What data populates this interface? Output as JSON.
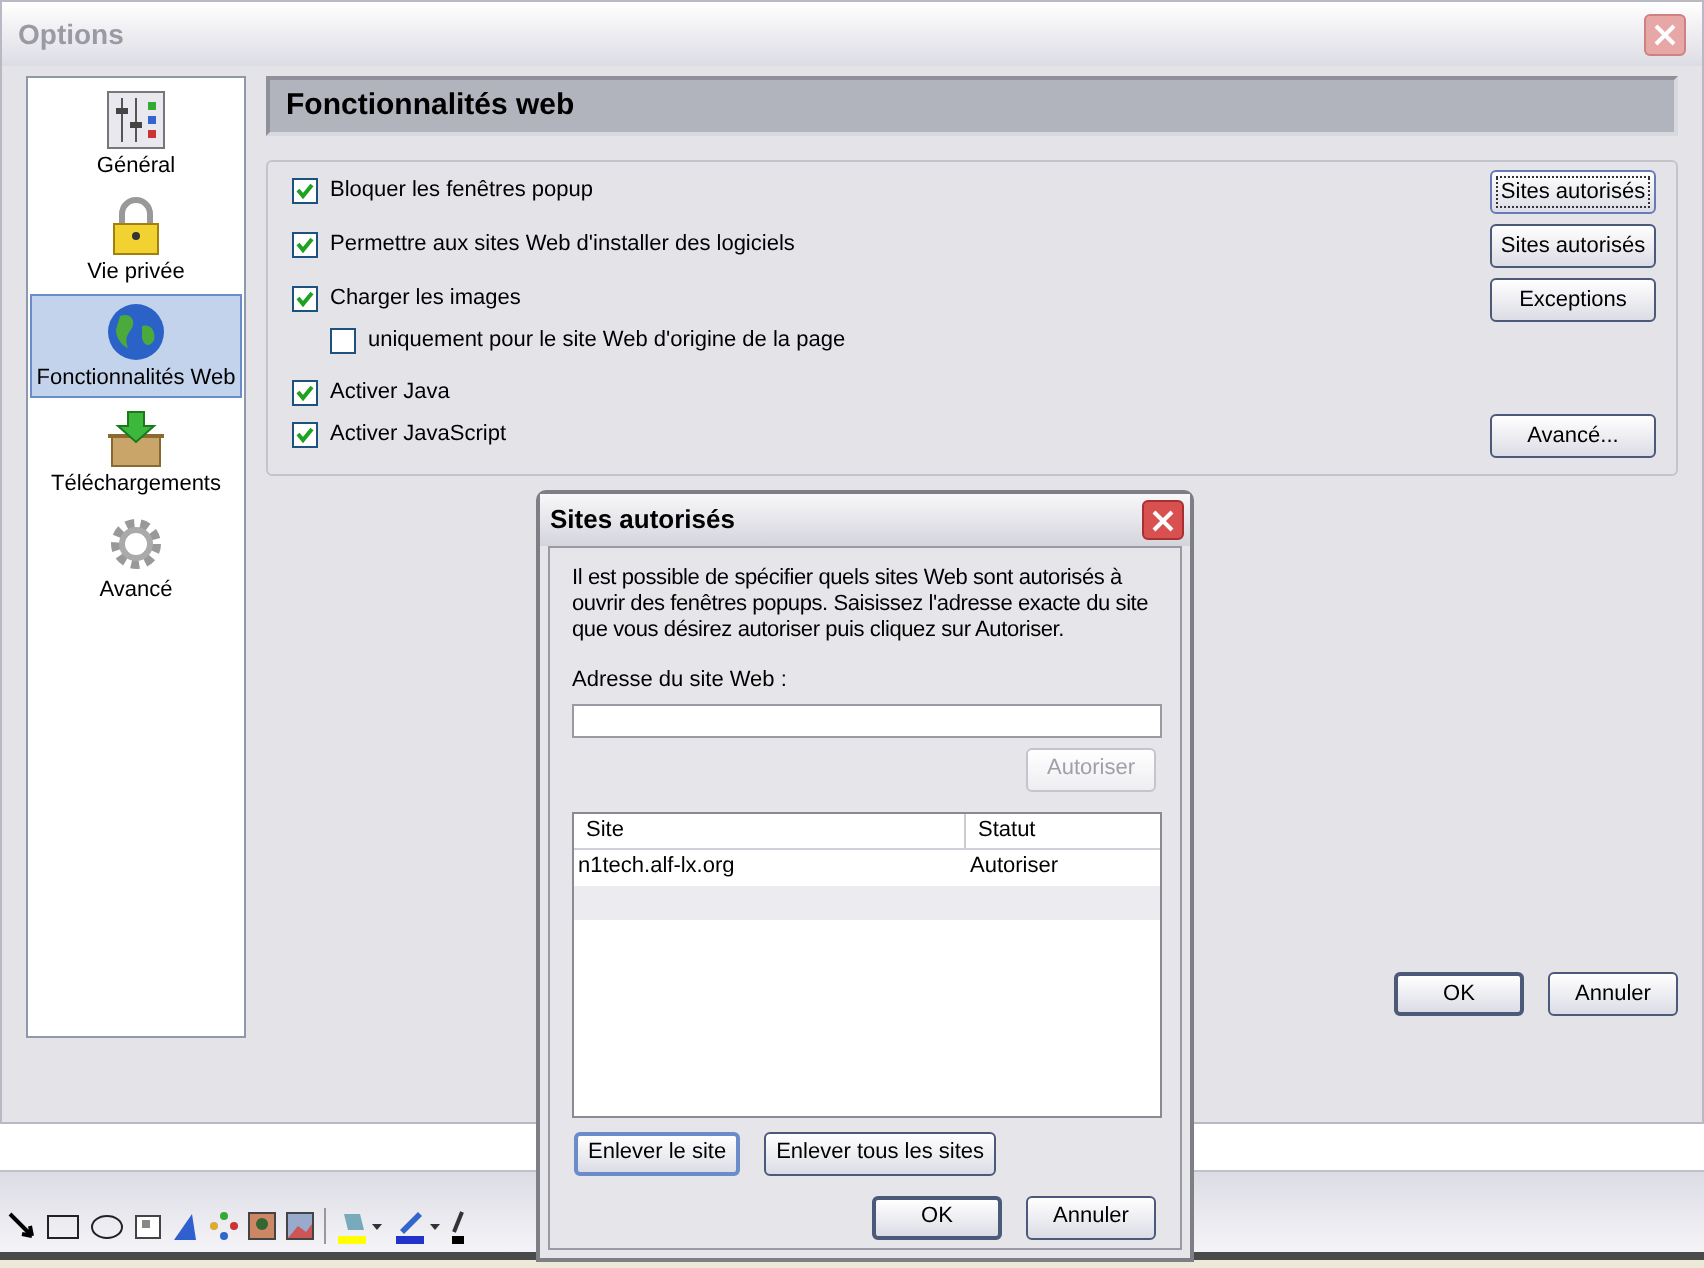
{
  "window": {
    "title": "Options"
  },
  "sidebar": {
    "items": [
      {
        "label": "Général",
        "selected": false
      },
      {
        "label": "Vie privée",
        "selected": false
      },
      {
        "label": "Fonctionnalités Web",
        "selected": true
      },
      {
        "label": "Téléchargements",
        "selected": false
      },
      {
        "label": "Avancé",
        "selected": false
      }
    ]
  },
  "section_title": "Fonctionnalités web",
  "options": [
    {
      "label": "Bloquer les fenêtres popup",
      "checked": true,
      "button": {
        "label": "Sites autorisés",
        "focused": true
      }
    },
    {
      "label": "Permettre aux sites Web d'installer des logiciels",
      "checked": true,
      "button": {
        "label": "Sites autorisés",
        "focused": false
      }
    },
    {
      "label": "Charger les images",
      "checked": true,
      "button": {
        "label": "Exceptions",
        "focused": false
      },
      "children": [
        {
          "label": "uniquement pour le site Web d'origine de la page",
          "checked": false
        }
      ]
    },
    {
      "label": "Activer Java",
      "checked": true
    },
    {
      "label": "Activer JavaScript",
      "checked": true,
      "button": {
        "label": "Avancé...",
        "focused": false
      }
    }
  ],
  "footer_buttons": [
    {
      "label": "OK",
      "default": true
    },
    {
      "label": "Annuler",
      "default": false
    }
  ],
  "dialog": {
    "title": "Sites autorisés",
    "description": "Il est possible de spécifier quels sites Web sont autorisés à ouvrir des fenêtres popups. Saisissez l'adresse exacte du site que vous désirez autoriser puis cliquez sur Autoriser.",
    "field_label": "Adresse du site Web :",
    "allow_button": {
      "label": "Autoriser",
      "disabled": true
    },
    "table": {
      "columns": [
        "Site",
        "Statut"
      ],
      "rows": [
        {
          "site": "n1tech.alf-lx.org",
          "status": "Autoriser"
        }
      ]
    },
    "remove_buttons": [
      {
        "label": "Enlever le site",
        "focused": true
      },
      {
        "label": "Enlever tous les sites",
        "focused": false
      }
    ],
    "buttons": [
      {
        "label": "OK",
        "default": true
      },
      {
        "label": "Annuler",
        "default": false
      }
    ]
  }
}
